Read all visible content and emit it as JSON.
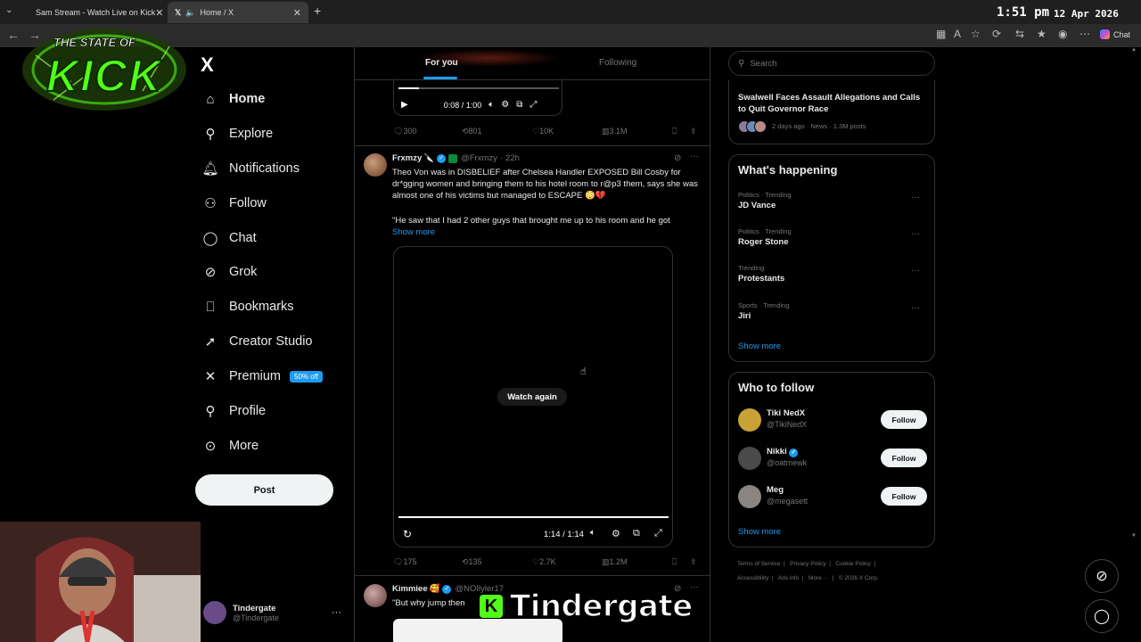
{
  "browser": {
    "tabs": [
      {
        "title": "Sam Stream - Watch Live on Kick",
        "active": false
      },
      {
        "title": "Home / X",
        "active": true
      }
    ],
    "clock": "1:51 pm",
    "date": "12 Apr 2026",
    "chat_label": "Chat"
  },
  "overlay": {
    "logo_text_top": "THE STATE OF",
    "logo_text_main": "KICK",
    "caption": "Tindergate",
    "caption_icon": "K"
  },
  "sidebar": {
    "logo": "X",
    "items": [
      {
        "label": "Home",
        "icon": "home-icon",
        "active": true
      },
      {
        "label": "Explore",
        "icon": "search-icon"
      },
      {
        "label": "Notifications",
        "icon": "bell-icon"
      },
      {
        "label": "Follow",
        "icon": "person-plus-icon"
      },
      {
        "label": "Chat",
        "icon": "chat-icon"
      },
      {
        "label": "Grok",
        "icon": "grok-icon"
      },
      {
        "label": "Bookmarks",
        "icon": "bookmark-icon"
      },
      {
        "label": "Creator Studio",
        "icon": "rocket-icon"
      },
      {
        "label": "Premium",
        "icon": "x-icon",
        "badge": "50% off"
      },
      {
        "label": "Profile",
        "icon": "person-icon"
      },
      {
        "label": "More",
        "icon": "more-circle-icon"
      }
    ],
    "post_label": "Post",
    "account": {
      "name": "Tindergate",
      "handle": "@Tindergate"
    }
  },
  "feed": {
    "tabs": [
      {
        "label": "For you",
        "active": true
      },
      {
        "label": "Following",
        "active": false
      }
    ],
    "tweet1": {
      "video_time": "0:08 / 1:00",
      "replies": "300",
      "retweets": "801",
      "likes": "10K",
      "views": "3.1M"
    },
    "tweet2": {
      "name": "Frxmzy",
      "handle": "@Frxmzy",
      "time": "22h",
      "text": "Theo Von was in DISBELIEF after Chelsea Handler  EXPOSED Bill Cosby for dr*gging women and bringing them to his hotel room to r@p3 them, says she was almost one of his victims but managed to ESCAPE 😳💔",
      "quote": "\"He saw that I had 2 other guys that brought me up to his room and he got",
      "show_more": "Show more",
      "watch_again": "Watch again",
      "video_time": "1:14 / 1:14",
      "replies": "175",
      "retweets": "135",
      "likes": "2.7K",
      "views": "1.2M"
    },
    "tweet3": {
      "name": "Kimmiee",
      "handle": "@NOIlyler17",
      "text": "\"But why jump then"
    }
  },
  "right": {
    "search_placeholder": "Search",
    "news": {
      "title": "Swalwell Faces Assault Allegations and Calls to Quit Governor Race",
      "meta": "2 days ago · News · 1.3M posts"
    },
    "happening": {
      "title": "What's happening",
      "trends": [
        {
          "category": "Politics · Trending",
          "name": "JD Vance"
        },
        {
          "category": "Politics · Trending",
          "name": "Roger Stone"
        },
        {
          "category": "Trending",
          "name": "Protestants"
        },
        {
          "category": "Sports · Trending",
          "name": "Jiri"
        }
      ],
      "show_more": "Show more"
    },
    "who_to_follow": {
      "title": "Who to follow",
      "users": [
        {
          "name": "Tiki NedX",
          "handle": "@TikiNedX",
          "color": "#c9a236"
        },
        {
          "name": "Nikki",
          "handle": "@oatmewk",
          "color": "#4a4a4a"
        },
        {
          "name": "Meg",
          "handle": "@megasett",
          "color": "#8a8580"
        }
      ],
      "follow_label": "Follow",
      "show_more": "Show more"
    },
    "footer": {
      "line1": [
        "Terms of Service",
        "|",
        "Privacy Policy",
        "|",
        "Cookie Policy",
        "|"
      ],
      "line2": [
        "Accessibility",
        "|",
        "Ads info",
        "|",
        "More ···",
        "|",
        "© 2026 X Corp."
      ]
    }
  }
}
